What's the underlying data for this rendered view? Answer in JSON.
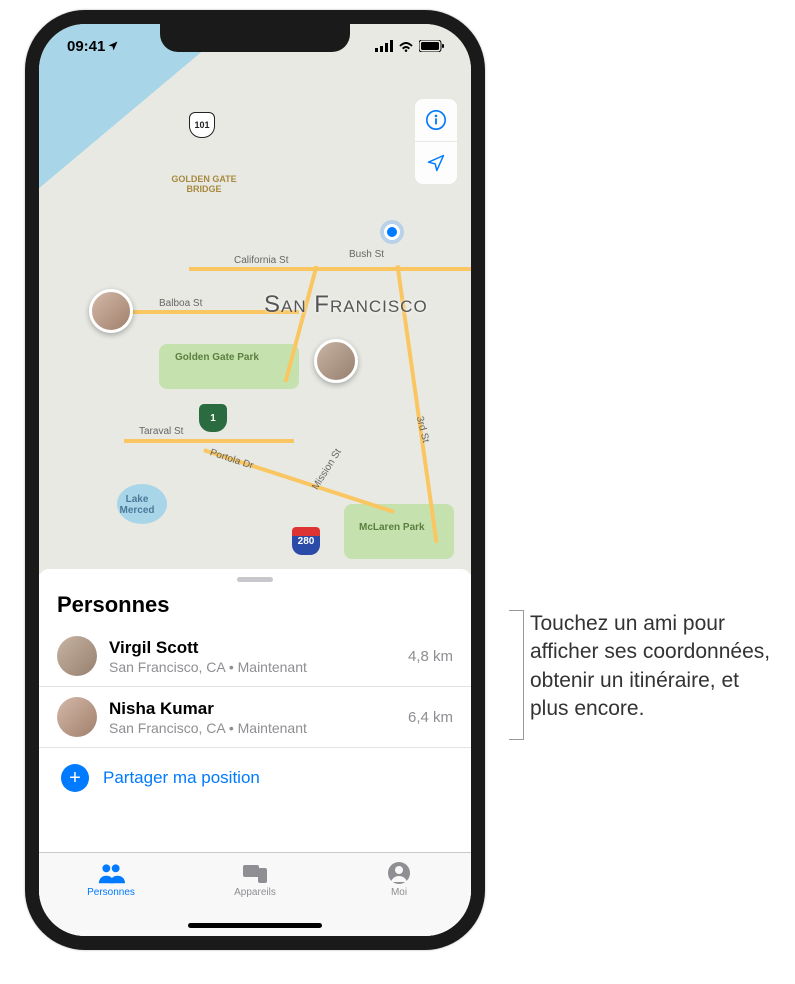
{
  "statusBar": {
    "time": "09:41"
  },
  "map": {
    "cityLabel": "San Francisco",
    "labels": {
      "goldenGateBridge": "GOLDEN GATE BRIDGE",
      "goldenGatePark": "Golden Gate Park",
      "lakeMerced": "Lake Merced",
      "mclarenPark": "McLaren Park",
      "californiaSt": "California St",
      "bushSt": "Bush St",
      "balboaSt": "Balboa St",
      "taravalSt": "Taraval St",
      "missionSt": "Mission St",
      "third": "3rd St",
      "divisSt": " ",
      "portolaDr": "Portola Dr"
    },
    "controls": {
      "info": "i",
      "location": "➤"
    },
    "highways": {
      "h101": "101",
      "h1": "1",
      "h280": "280"
    }
  },
  "panel": {
    "title": "Personnes",
    "people": [
      {
        "name": "Virgil Scott",
        "sub": "San Francisco, CA • Maintenant",
        "distance": "4,8 km"
      },
      {
        "name": "Nisha Kumar",
        "sub": "San Francisco, CA • Maintenant",
        "distance": "6,4 km"
      }
    ],
    "shareLabel": "Partager ma position"
  },
  "tabs": {
    "people": "Personnes",
    "devices": "Appareils",
    "me": "Moi"
  },
  "callout": "Touchez un ami pour afficher ses coordonnées, obtenir un itinéraire, et plus encore."
}
